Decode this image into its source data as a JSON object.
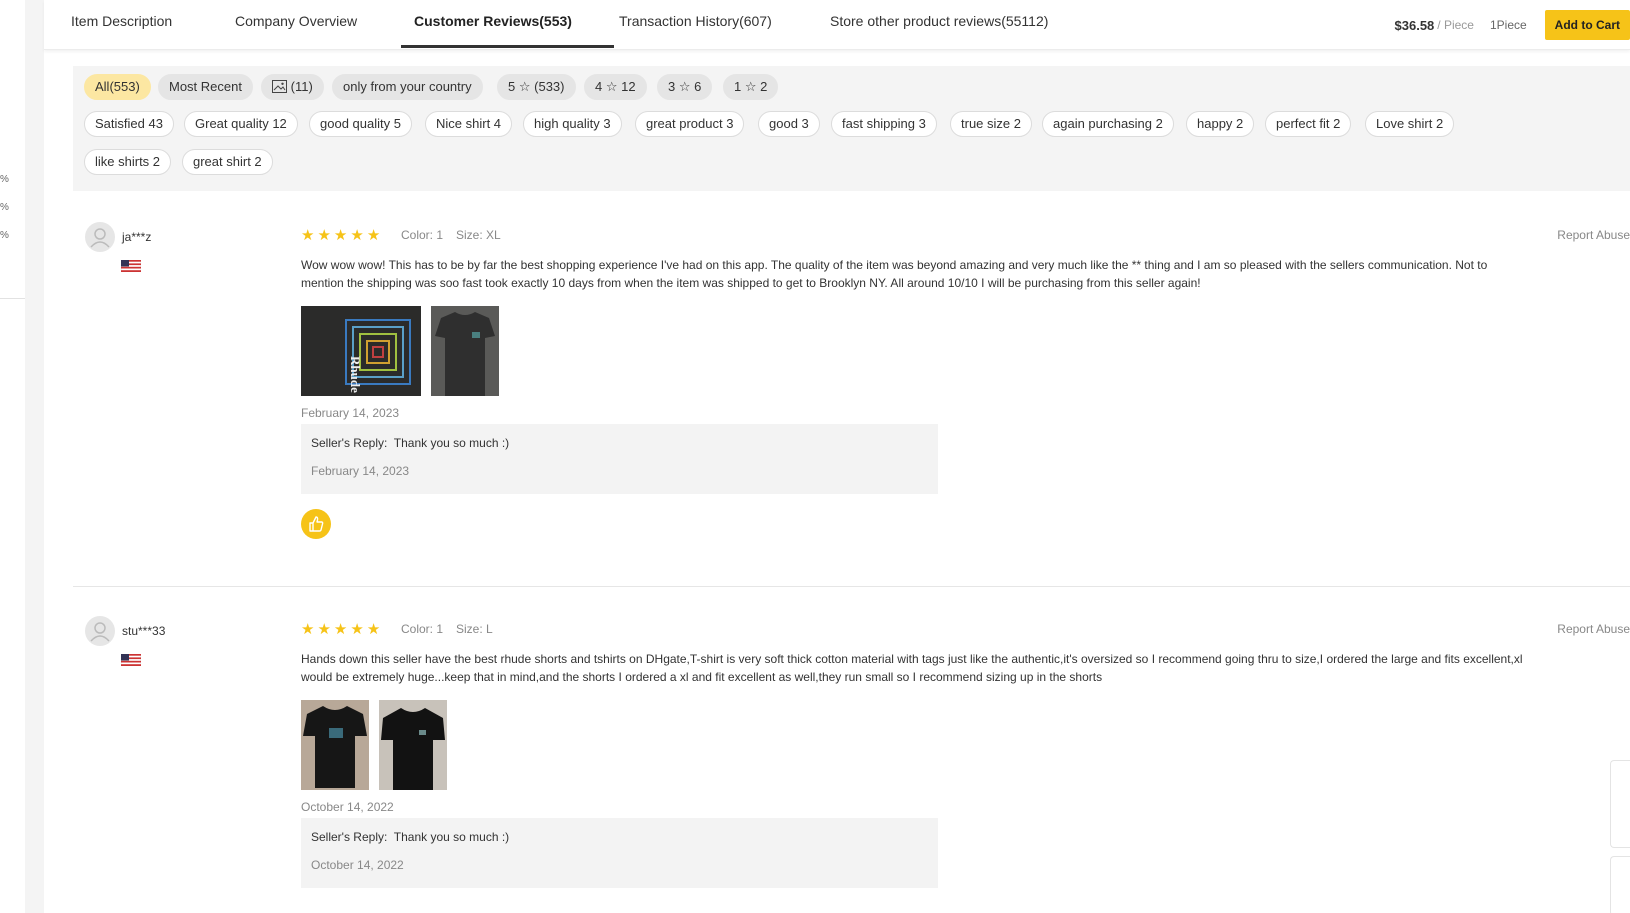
{
  "left_strip": {
    "pct_marks": [
      "%",
      "%",
      "%"
    ]
  },
  "tabs": [
    {
      "label": "Item Description",
      "active": false
    },
    {
      "label": "Company Overview",
      "active": false
    },
    {
      "label": "Customer Reviews(553)",
      "active": true
    },
    {
      "label": "Transaction History(607)",
      "active": false
    },
    {
      "label": "Store other product reviews(55112)",
      "active": false
    }
  ],
  "buybox": {
    "price": "$36.58",
    "unit": "/ Piece",
    "qty": "1Piece",
    "cart_label": "Add to Cart"
  },
  "filters": {
    "row1": [
      {
        "label": "All(553)",
        "style": "active"
      },
      {
        "label": "Most Recent",
        "style": "filled"
      },
      {
        "label": "(11)",
        "style": "filled",
        "icon": "image-icon"
      },
      {
        "label": "only from your country",
        "style": "filled"
      },
      {
        "pre": "5",
        "post": "(533)",
        "style": "filled",
        "icon": "star-outline-icon"
      },
      {
        "pre": "4",
        "post": "12",
        "style": "filled",
        "icon": "star-outline-icon"
      },
      {
        "pre": "3",
        "post": "6",
        "style": "filled",
        "icon": "star-outline-icon"
      },
      {
        "pre": "1",
        "post": "2",
        "style": "filled",
        "icon": "star-outline-icon"
      }
    ],
    "tags": [
      "Satisfied 43",
      "Great quality 12",
      "good quality 5",
      "Nice shirt 4",
      "high quality 3",
      "great product 3",
      "good 3",
      "fast shipping 3",
      "true size 2",
      "again purchasing 2",
      "happy 2",
      "perfect fit 2",
      "Love shirt 2",
      "like shirts 2",
      "great shirt 2"
    ]
  },
  "reviews": [
    {
      "user": "ja***z",
      "rating": 5,
      "color": "Color: 1",
      "size": "Size: XL",
      "report_label": "Report Abuse",
      "text": "Wow wow wow! This has to be by far the best shopping experience I've had on this app. The quality of the item was beyond amazing and very much like the ** thing and I am so pleased with the sellers communication. Not to mention the shipping was soo fast took exactly 10 days from when the item was shipped to get to Brooklyn NY. All around 10/10 I will be purchasing from this seller again!",
      "photo_text": "Rhude",
      "date": "February 14, 2023",
      "reply_label": "Seller's Reply:",
      "reply_text": "Thank you so much :)",
      "reply_date": "February 14, 2023"
    },
    {
      "user": "stu***33",
      "rating": 5,
      "color": "Color: 1",
      "size": "Size: L",
      "report_label": "Report Abuse",
      "text": "Hands down this seller have the best rhude shorts and tshirts on DHgate,T-shirt is very soft thick cotton material with tags just like the authentic,it's oversized so I recommend going thru to size,I ordered the large and fits excellent,xl would be extremely huge...keep that in mind,and the shorts I ordered a xl and fit excellent as well,they run small so I recommend sizing up in the shorts",
      "date": "October 14, 2022",
      "reply_label": "Seller's Reply:",
      "reply_text": "Thank you so much :)",
      "reply_date": "October 14, 2022"
    }
  ],
  "colors": {
    "accent": "#f6c318",
    "active_chip": "#fce7a2",
    "star": "#f6c318"
  }
}
